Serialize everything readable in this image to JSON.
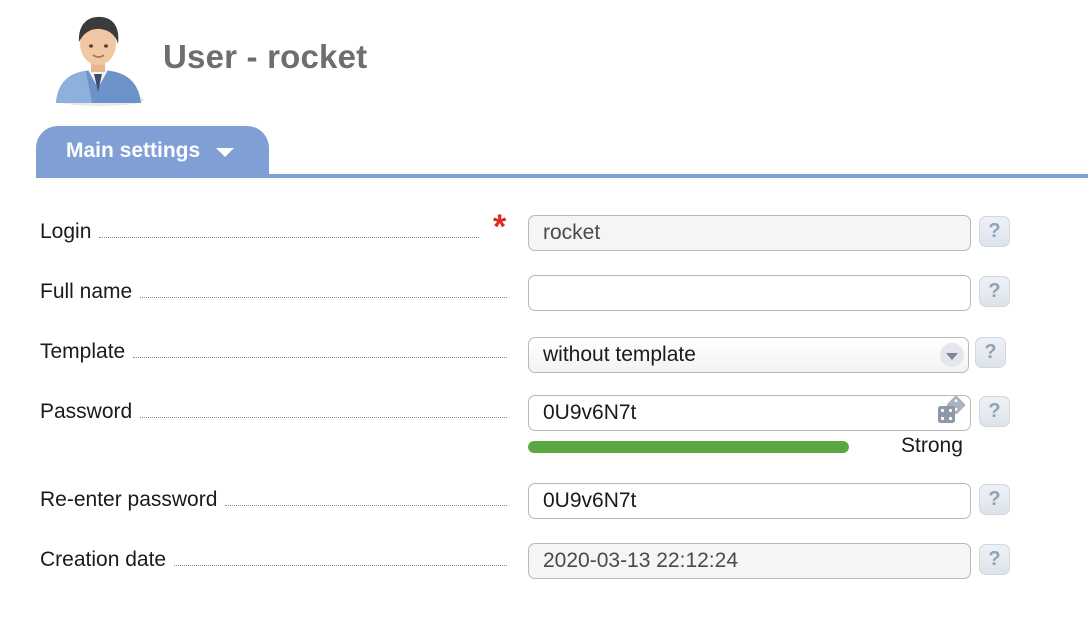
{
  "header": {
    "title": "User - rocket",
    "avatar_icon": "user-avatar-icon"
  },
  "tabs": [
    {
      "label": "Main settings",
      "icon": "chevron-down-icon",
      "active": true
    }
  ],
  "form": {
    "login": {
      "label": "Login",
      "value": "rocket",
      "required": "*"
    },
    "full_name": {
      "label": "Full name",
      "value": ""
    },
    "template": {
      "label": "Template",
      "value": "without template"
    },
    "password": {
      "label": "Password",
      "value": "0U9v6N7t",
      "generate_icon": "dice-icon",
      "strength_label": "Strong",
      "strength": 1.0
    },
    "reenter_password": {
      "label": "Re-enter password",
      "value": "0U9v6N7t"
    },
    "creation_date": {
      "label": "Creation date",
      "value": "2020-03-13 22:12:24"
    }
  },
  "help_label": "?",
  "colors": {
    "tab": "#7f9fd5",
    "required": "#e2281b",
    "strength": "#5aa641",
    "title": "#6e6e6e"
  }
}
